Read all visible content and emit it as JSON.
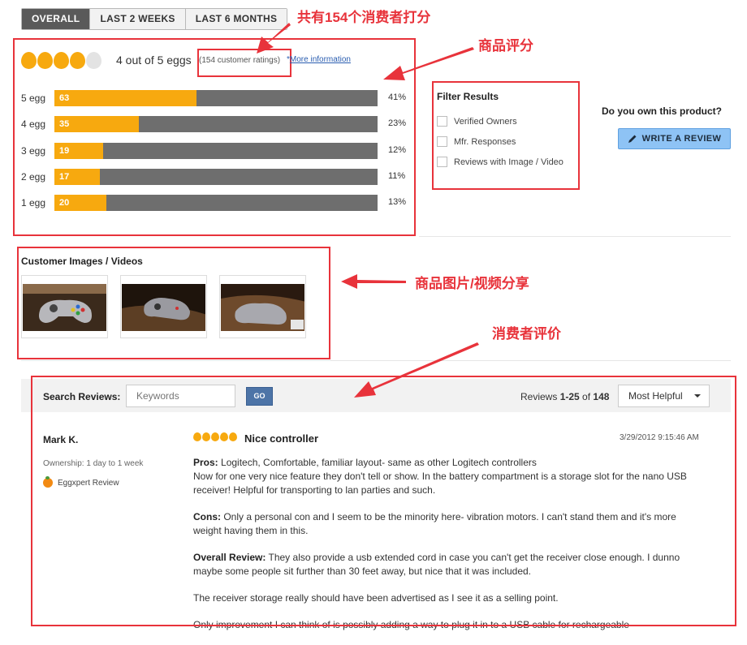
{
  "tabs": [
    {
      "label": "OVERALL",
      "active": true
    },
    {
      "label": "LAST 2 WEEKS",
      "active": false
    },
    {
      "label": "LAST 6 MONTHS",
      "active": false
    }
  ],
  "summary": {
    "eggs_filled": 4,
    "eggs_total": 5,
    "rating_text": "4 out of 5 eggs",
    "ratings_count_text": "(154 customer ratings)",
    "more_info_prefix": "*",
    "more_info_label": "More information",
    "rows": [
      {
        "label": "5 egg",
        "count": "63",
        "fraction": 0.41,
        "percent": "41%"
      },
      {
        "label": "4 egg",
        "count": "35",
        "fraction": 0.23,
        "percent": "23%"
      },
      {
        "label": "3 egg",
        "count": "19",
        "fraction": 0.12,
        "percent": "12%"
      },
      {
        "label": "2 egg",
        "count": "17",
        "fraction": 0.11,
        "percent": "11%"
      },
      {
        "label": "1 egg",
        "count": "20",
        "fraction": 0.13,
        "percent": "13%"
      }
    ]
  },
  "filter": {
    "title": "Filter Results",
    "options": [
      "Verified Owners",
      "Mfr. Responses",
      "Reviews with Image / Video"
    ]
  },
  "own_product": {
    "question": "Do you own this product?",
    "button_label": "WRITE A REVIEW"
  },
  "images_section": {
    "title": "Customer Images / Videos"
  },
  "annotations": {
    "ratings_count": "共有154个消费者打分",
    "product_rating": "商品评分",
    "images_share": "商品图片/视频分享",
    "consumer_reviews": "消费者评价"
  },
  "search": {
    "label": "Search Reviews:",
    "placeholder": "Keywords",
    "go_label": "GO",
    "count_prefix": "Reviews ",
    "count_range": "1-25",
    "count_of": " of ",
    "count_total": "148",
    "sort_selected": "Most Helpful"
  },
  "review": {
    "author": "Mark K.",
    "ownership": "Ownership: 1 day to 1 week",
    "eggxpert": "Eggxpert Review",
    "eggs": 5,
    "title": "Nice controller",
    "date": "3/29/2012 9:15:46 AM",
    "pros_label": "Pros:",
    "pros_text": " Logitech, Comfortable, familiar layout- same as other Logitech controllers",
    "pros_text2": "Now for one very nice feature they don't tell or show. In the battery compartment is a storage slot for the nano USB receiver! Helpful for transporting to lan parties and such.",
    "cons_label": "Cons:",
    "cons_text": " Only a personal con and I seem to be the minority here- vibration motors. I can't stand them and it's more weight having them in this.",
    "overall_label": "Overall Review:",
    "overall_text": " They also provide a usb extended cord in case you can't get the receiver close enough. I dunno maybe some people sit further than 30 feet away, but nice that it was included.",
    "extra1": "The receiver storage really should have been advertised as I see it as a selling point.",
    "extra2": "Only improvement I can think of is possibly adding a way to plug it in to a USB cable for rechargeable"
  },
  "colors": {
    "accent_orange": "#f7a90f",
    "bar_gray": "#6e6e6e",
    "annotation_red": "#e8333b",
    "go_blue": "#4d74a7",
    "write_btn_blue": "#8ec3f5"
  }
}
